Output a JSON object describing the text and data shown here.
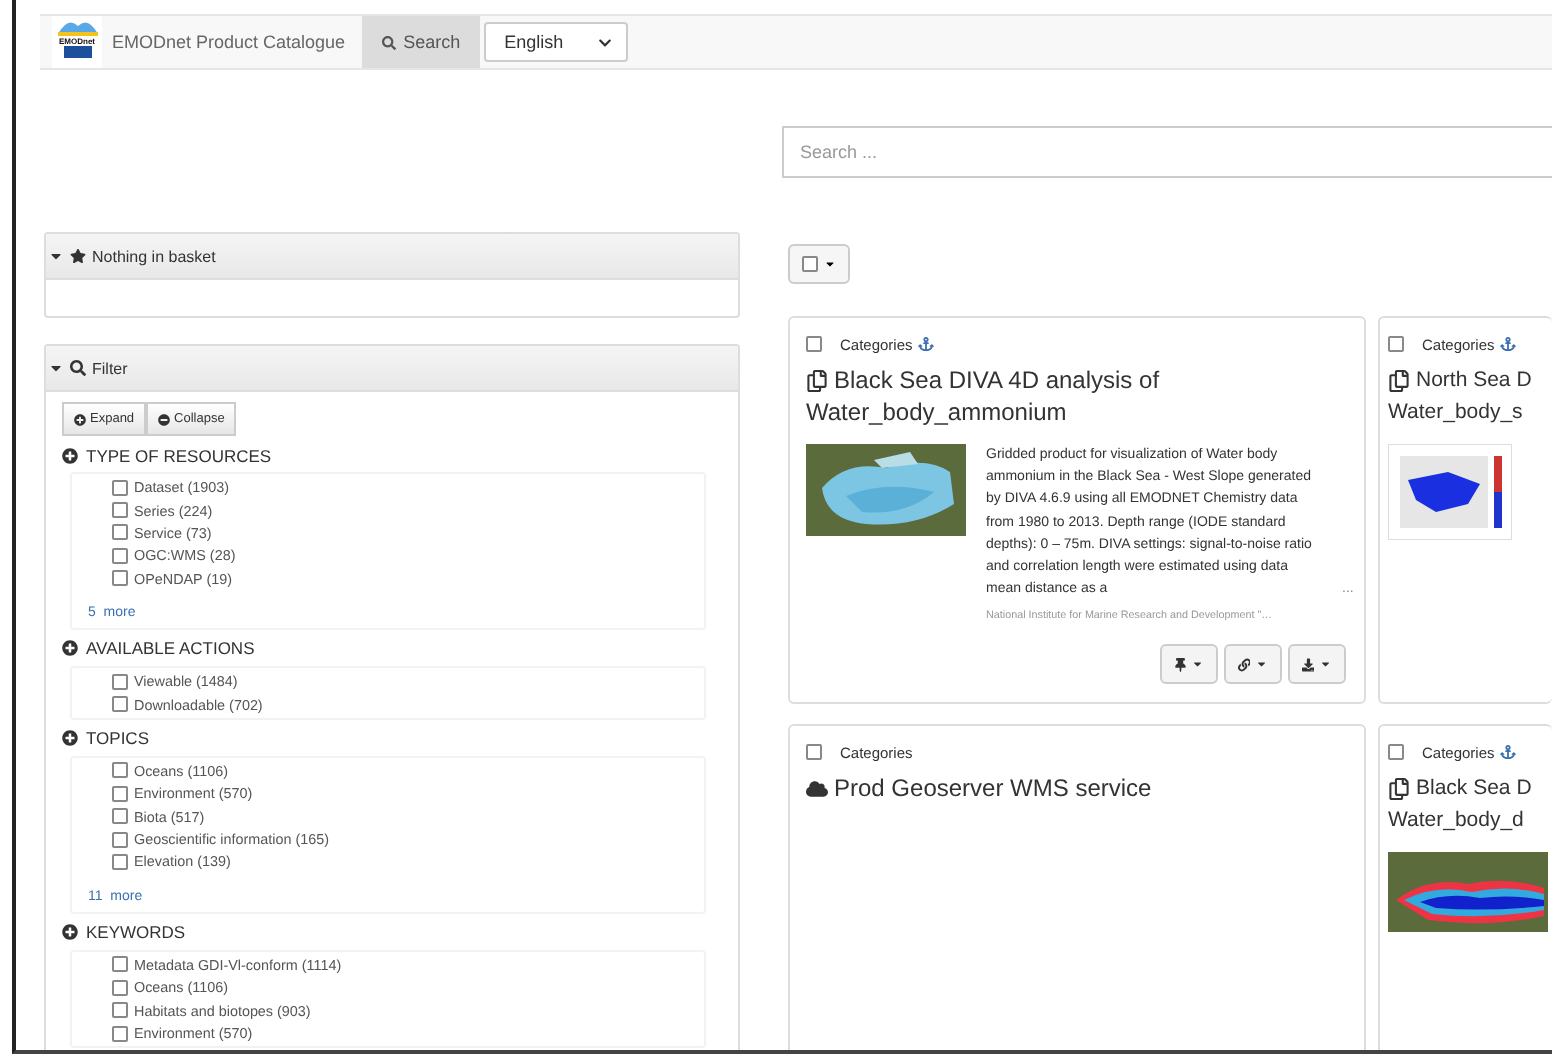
{
  "navbar": {
    "logo_text": "EMODnet",
    "title": "EMODnet Product Catalogue",
    "search_tab": {
      "label": "Search",
      "selected": true
    },
    "language": {
      "value": "English"
    }
  },
  "search": {
    "placeholder": "Search ..."
  },
  "basket": {
    "title": "Nothing in basket",
    "expanded": true
  },
  "filter": {
    "title": "Filter",
    "expanded": true,
    "buttons": [
      {
        "kind": "expand",
        "label": "Expand"
      },
      {
        "kind": "collapse",
        "label": "Collapse"
      }
    ],
    "sections": [
      {
        "title": "TYPE OF RESOURCES",
        "items": [
          {
            "label": "Dataset (1903)",
            "checked": false
          },
          {
            "label": "Series (224)",
            "checked": false
          },
          {
            "label": "Service (73)",
            "checked": false
          },
          {
            "label": "OGC:WMS (28)",
            "checked": false
          },
          {
            "label": "OPeNDAP (19)",
            "checked": false
          }
        ],
        "more": "5  more"
      },
      {
        "title": "AVAILABLE ACTIONS",
        "items": [
          {
            "label": "Viewable (1484)",
            "checked": false
          },
          {
            "label": "Downloadable (702)",
            "checked": false
          }
        ]
      },
      {
        "title": "TOPICS",
        "items": [
          {
            "label": "Oceans (1106)",
            "checked": false
          },
          {
            "label": "Environment (570)",
            "checked": false
          },
          {
            "label": "Biota (517)",
            "checked": false
          },
          {
            "label": "Geoscientific information (165)",
            "checked": false
          },
          {
            "label": "Elevation (139)",
            "checked": false
          }
        ],
        "more": "11  more"
      },
      {
        "title": "KEYWORDS",
        "items": [
          {
            "label": "Metadata GDI-Vl-conform (1114)",
            "checked": false
          },
          {
            "label": "Oceans (1106)",
            "checked": false
          },
          {
            "label": "Habitats and biotopes (903)",
            "checked": false
          },
          {
            "label": "Environment (570)",
            "checked": false
          }
        ]
      }
    ]
  },
  "results": {
    "select_all": {
      "checked": false
    },
    "cards": [
      {
        "kind": "dataset",
        "thumbnail": {
          "kind": "map"
        },
        "checked": false,
        "category": "Categories",
        "anchor": true,
        "title_lines": [
          "Black Sea DIVA 4D analysis of",
          "Water_body_ammonium"
        ],
        "description": "Gridded product for visualization of Water body ammonium in the Black Sea - West Slope generated by DIVA 4.6.9 using all EMODNET Chemistry data from 1980 to 2013. Depth range (IODE standard depths): 0 – 75m. DIVA settings: signal-to-noise ratio and correlation length were estimated using data mean distance as a",
        "more_mark": "...",
        "organisation": "National Institute for Marine Research and Development \"…",
        "actions": [
          {
            "kind": "pin"
          },
          {
            "kind": "link"
          },
          {
            "kind": "download"
          }
        ]
      },
      {
        "kind": "dataset",
        "thumbnail": {
          "kind": "plot"
        },
        "checked": false,
        "category": "Categories",
        "anchor": true,
        "title_lines": [
          "North Sea D",
          "Water_body_s"
        ]
      },
      {
        "kind": "service",
        "checked": false,
        "category": "Categories",
        "anchor": false,
        "title_lines": [
          "Prod Geoserver WMS service"
        ]
      },
      {
        "kind": "dataset",
        "thumbnail": {
          "kind": "heatmap"
        },
        "checked": false,
        "category": "Categories",
        "anchor": true,
        "title_lines": [
          "Black Sea D",
          "Water_body_d"
        ]
      }
    ]
  }
}
